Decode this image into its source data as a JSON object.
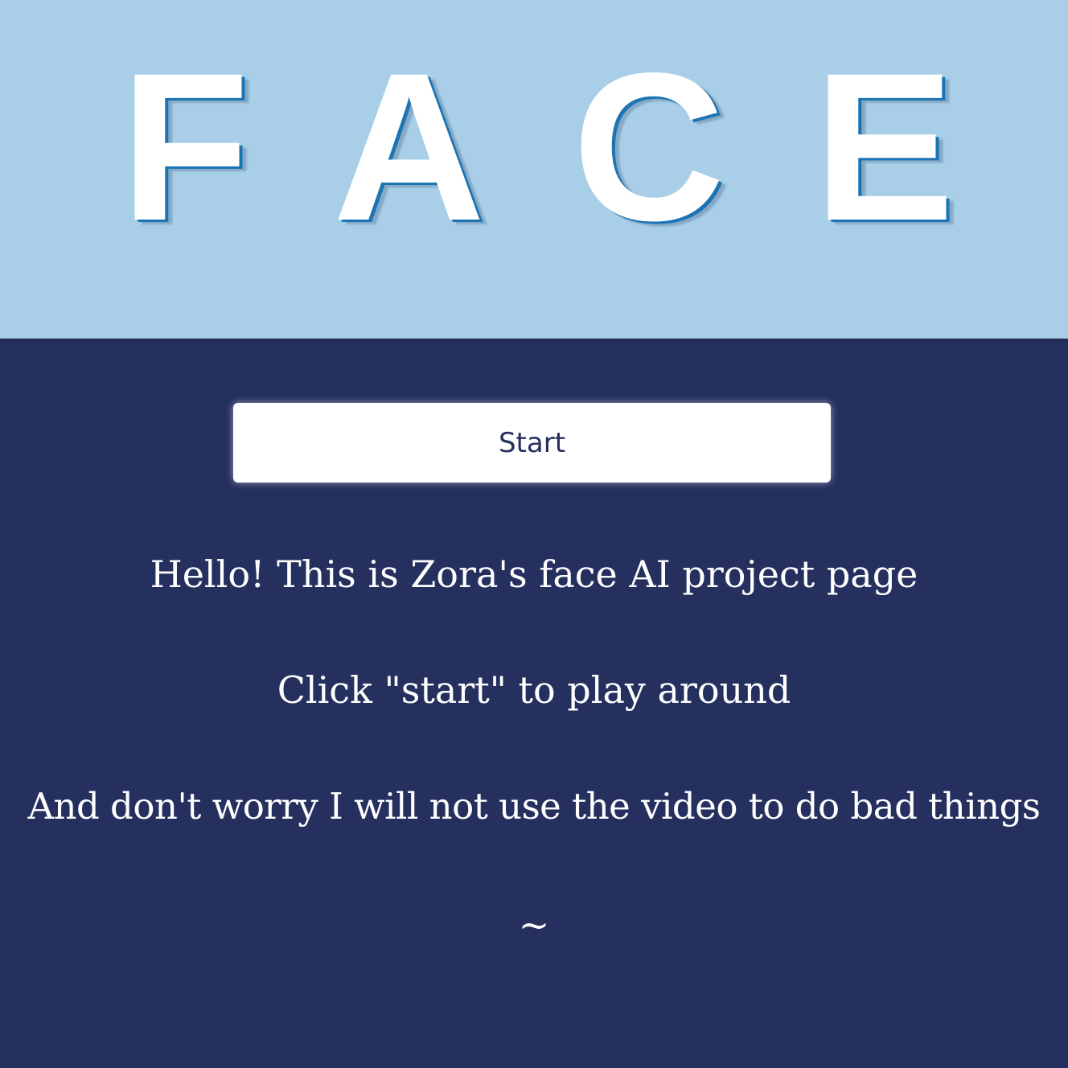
{
  "header": {
    "letters": [
      "F",
      "A",
      "C",
      "E"
    ]
  },
  "start_button": {
    "label": "Start"
  },
  "messages": {
    "greeting": "Hello! This is Zora's face AI project page",
    "instruction": "Click \"start\" to play around",
    "reassurance": "And don't worry I will not use the video to do bad things",
    "tilde": "~"
  },
  "colors": {
    "header_background": "#a8cfe7",
    "page_background": "#25305f",
    "letter_shadow": "#1b74b3",
    "button_text": "#25305f"
  }
}
